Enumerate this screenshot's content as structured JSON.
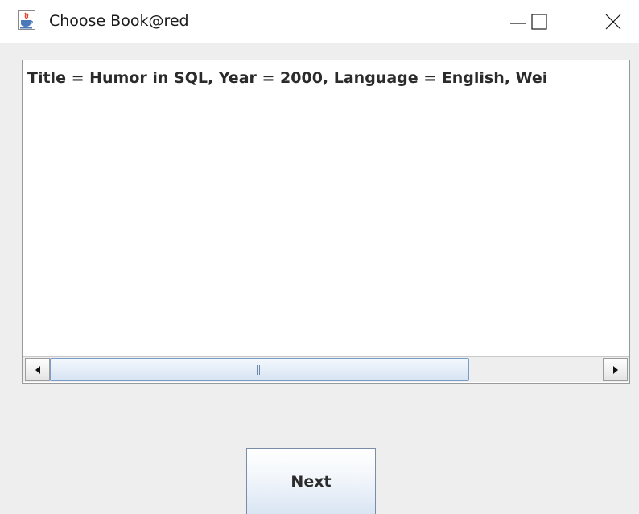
{
  "window": {
    "title": "Choose Book@red",
    "app_icon": "java-cup-icon",
    "controls": [
      "minimize-icon",
      "maximize-icon",
      "close-icon"
    ]
  },
  "list": {
    "items": [
      "Title = Humor in SQL, Year = 2000, Language = English, Wei"
    ]
  },
  "scrollbar": {
    "position": 0.0,
    "visible_fraction": 0.76
  },
  "buttons": {
    "next_label": "Next"
  }
}
